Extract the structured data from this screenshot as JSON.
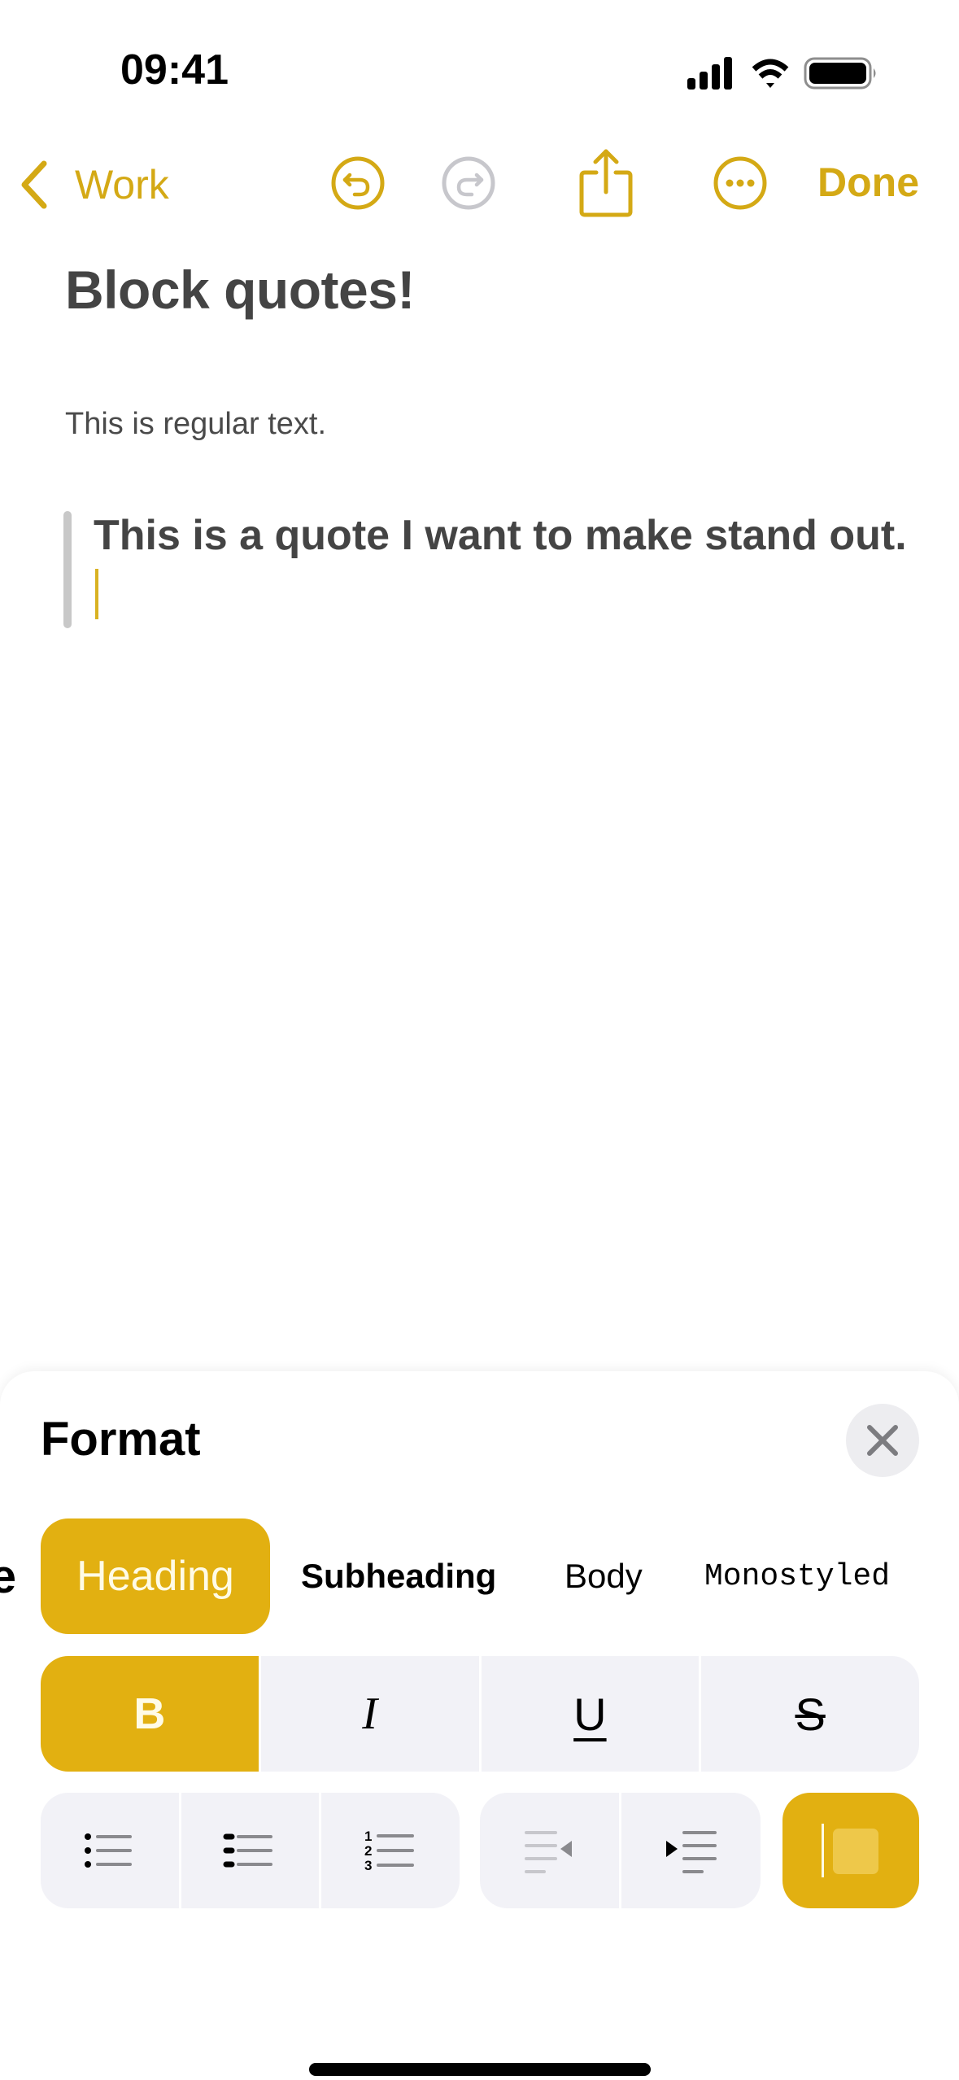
{
  "status_bar": {
    "time": "09:41",
    "icons": [
      "cellular-signal-icon",
      "wifi-icon",
      "battery-icon"
    ]
  },
  "nav": {
    "back_label": "Work",
    "back_icon": "chevron-left-icon",
    "undo_icon": "undo-icon",
    "redo_icon": "redo-icon",
    "redo_enabled": false,
    "share_icon": "share-icon",
    "more_icon": "ellipsis-circle-icon",
    "done_label": "Done"
  },
  "note": {
    "title": "Block quotes!",
    "regular_text": "This is regular text.",
    "quote_text": "This is a quote I want to make stand out."
  },
  "format_sheet": {
    "title": "Format",
    "close_icon": "close-icon",
    "styles": [
      {
        "label": "Title",
        "visible_fragment": "e",
        "selected": false
      },
      {
        "label": "Heading",
        "selected": true
      },
      {
        "label": "Subheading",
        "selected": false
      },
      {
        "label": "Body",
        "selected": false
      },
      {
        "label": "Monostyled",
        "selected": false
      }
    ],
    "text_formats": [
      {
        "label": "B",
        "name": "bold",
        "active": true
      },
      {
        "label": "I",
        "name": "italic",
        "active": false
      },
      {
        "label": "U",
        "name": "underline",
        "active": false
      },
      {
        "label": "S",
        "name": "strikethrough",
        "active": false
      }
    ],
    "list_buttons": [
      {
        "name": "bulleted-list",
        "icon": "bulleted-list-icon"
      },
      {
        "name": "dashed-list",
        "icon": "dashed-list-icon"
      },
      {
        "name": "numbered-list",
        "icon": "numbered-list-icon",
        "numbers": [
          "1",
          "2",
          "3"
        ]
      }
    ],
    "indent_buttons": [
      {
        "name": "decrease-indent",
        "icon": "outdent-icon",
        "enabled": false
      },
      {
        "name": "increase-indent",
        "icon": "indent-icon",
        "enabled": true
      }
    ],
    "block_quote": {
      "name": "block-quote",
      "icon": "block-quote-icon",
      "active": true
    }
  },
  "colors": {
    "accent": "#d4a915",
    "accent_fill": "#e2b011",
    "button_bg": "#f2f2f7",
    "disabled": "#c7c7cc",
    "note_text": "#444444"
  }
}
